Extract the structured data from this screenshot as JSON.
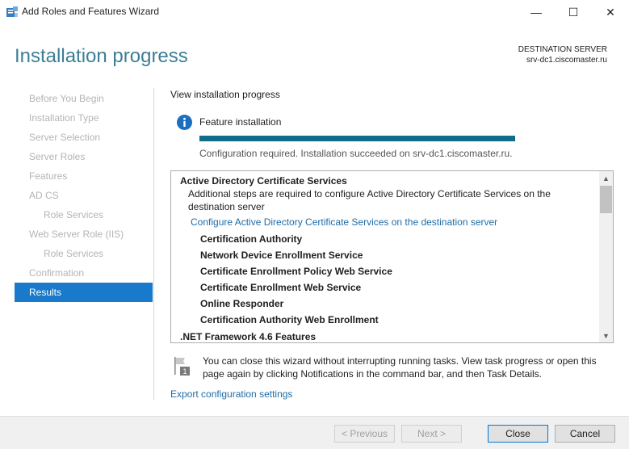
{
  "window": {
    "title": "Add Roles and Features Wizard",
    "app_icon": "server-manager-icon",
    "controls": {
      "minimize": "—",
      "maximize": "☐",
      "close": "✕"
    }
  },
  "header": {
    "title": "Installation progress",
    "destination_label": "DESTINATION SERVER",
    "destination_server": "srv-dc1.ciscomaster.ru"
  },
  "nav": {
    "items": [
      {
        "label": "Before You Begin",
        "level": 0,
        "active": false
      },
      {
        "label": "Installation Type",
        "level": 0,
        "active": false
      },
      {
        "label": "Server Selection",
        "level": 0,
        "active": false
      },
      {
        "label": "Server Roles",
        "level": 0,
        "active": false
      },
      {
        "label": "Features",
        "level": 0,
        "active": false
      },
      {
        "label": "AD CS",
        "level": 0,
        "active": false
      },
      {
        "label": "Role Services",
        "level": 1,
        "active": false
      },
      {
        "label": "Web Server Role (IIS)",
        "level": 0,
        "active": false
      },
      {
        "label": "Role Services",
        "level": 1,
        "active": false
      },
      {
        "label": "Confirmation",
        "level": 0,
        "active": false
      },
      {
        "label": "Results",
        "level": 0,
        "active": true
      }
    ]
  },
  "main": {
    "section_title": "View installation progress",
    "feature_label": "Feature installation",
    "progress_fraction": 1.0,
    "status_text": "Configuration required. Installation succeeded on srv-dc1.ciscomaster.ru.",
    "results": {
      "heading": "Active Directory Certificate Services",
      "steps_line1": "Additional steps are required to configure Active Directory Certificate Services on the",
      "steps_line2": "destination server",
      "configure_link": "Configure Active Directory Certificate Services on the destination server",
      "role_services": [
        "Certification Authority",
        "Network Device Enrollment Service",
        "Certificate Enrollment Policy Web Service",
        "Certificate Enrollment Web Service",
        "Online Responder",
        "Certification Authority Web Enrollment"
      ],
      "next_heading": ".NET Framework 4.6 Features"
    },
    "notice": "You can close this wizard without interrupting running tasks. View task progress or open this page again by clicking Notifications in the command bar, and then Task Details.",
    "export_link": "Export configuration settings"
  },
  "footer": {
    "previous": "< Previous",
    "next": "Next >",
    "close": "Close",
    "cancel": "Cancel"
  },
  "colors": {
    "accent_title": "#3c7f95",
    "nav_active": "#1979ca",
    "progress": "#106c89",
    "link": "#1e6ca7"
  }
}
